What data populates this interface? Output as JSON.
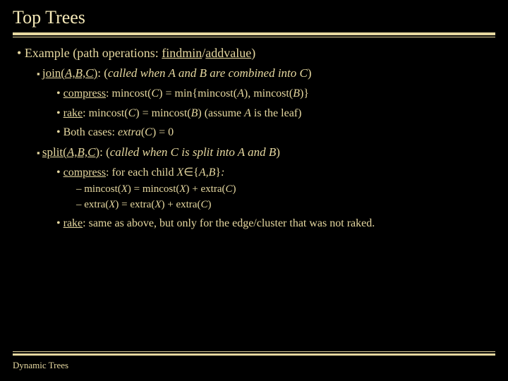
{
  "title": "Top Trees",
  "example_prefix": "Example (path operations: ",
  "op1": "findmin",
  "sep": "/",
  "op2": "addvalue",
  "paren_close": ")",
  "join_label": "join(",
  "join_args": "A,B,C",
  "join_close": ")",
  "join_desc_open": ": (",
  "join_desc_body": "called when A and B are combined into C",
  "join_desc_close": ")",
  "join_b1_a": "compress",
  "join_b1_b": ": mincost(",
  "join_b1_c": "C",
  "join_b1_d": ") = min{mincost(",
  "join_b1_e": "A",
  "join_b1_f": "), mincost(",
  "join_b1_g": "B",
  "join_b1_h": ")}",
  "join_b2_a": "rake",
  "join_b2_b": ": mincost(",
  "join_b2_c": "C",
  "join_b2_d": ") = mincost(",
  "join_b2_e": "B",
  "join_b2_f": ") (assume ",
  "join_b2_g": "A",
  "join_b2_h": " is the leaf)",
  "join_b3_a": "Both cases: ",
  "join_b3_b": "extra",
  "join_b3_c": "(",
  "join_b3_d": "C",
  "join_b3_e": ") = 0",
  "split_label": "split(",
  "split_args": "A,B,C",
  "split_close": ")",
  "split_desc_open": ": (",
  "split_desc_body": "called when C is split into A and B",
  "split_desc_close": ")",
  "split_b1_a": "compress",
  "split_b1_b": ": for each child ",
  "split_b1_c": "X",
  "split_b1_d": "∈{",
  "split_b1_e": "A,B",
  "split_b1_f": "}",
  "split_b1_g": ":",
  "split_s1_a": "mincost(",
  "split_s1_b": "X",
  "split_s1_c": ") = mincost(",
  "split_s1_d": "X",
  "split_s1_e": ") + extra(",
  "split_s1_f": "C",
  "split_s1_g": ")",
  "split_s2_a": "extra(",
  "split_s2_b": "X",
  "split_s2_c": ") = extra(",
  "split_s2_d": "X",
  "split_s2_e": ") + extra(",
  "split_s2_f": "C",
  "split_s2_g": ")",
  "split_b2_a": "rake",
  "split_b2_b": ": same as above, but only for the edge/cluster that was not raked.",
  "footer": "Dynamic Trees"
}
